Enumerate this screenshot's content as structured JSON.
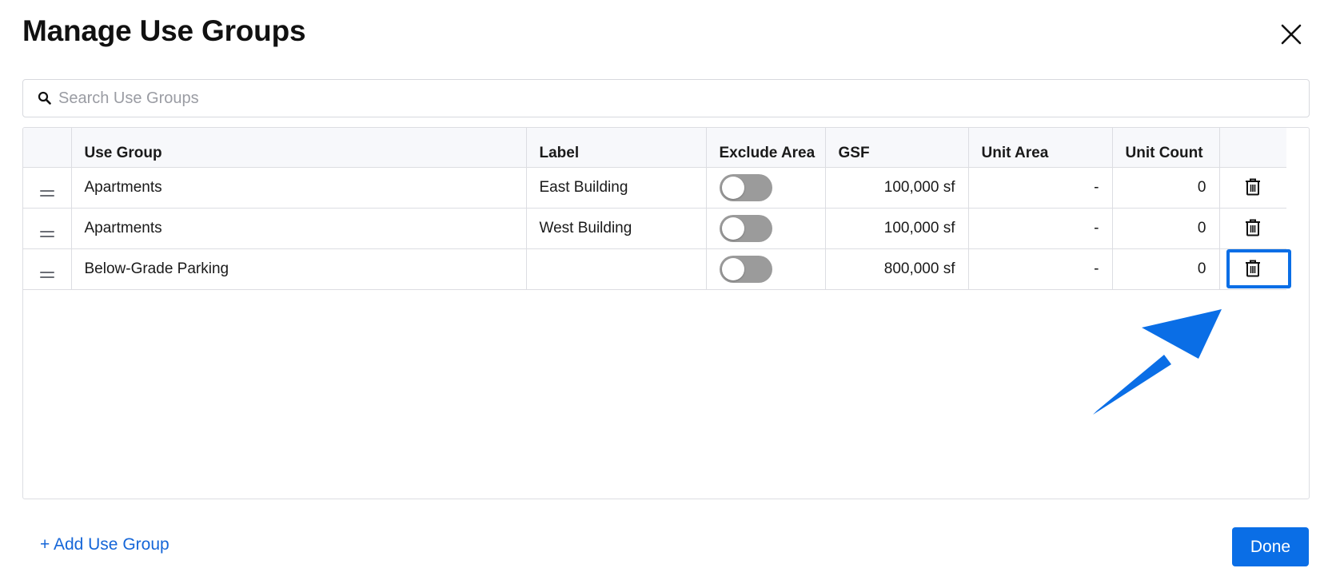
{
  "dialog": {
    "title": "Manage Use Groups",
    "close_icon": "close-icon"
  },
  "search": {
    "placeholder": "Search Use Groups",
    "value": "",
    "icon": "search-icon"
  },
  "table": {
    "columns": [
      "",
      "Use Group",
      "Label",
      "Exclude Area",
      "GSF",
      "Unit Area",
      "Unit Count",
      ""
    ],
    "rows": [
      {
        "use_group": "Apartments",
        "label": "East Building",
        "exclude_area": false,
        "gsf": "100,000 sf",
        "unit_area": "-",
        "unit_count": "0"
      },
      {
        "use_group": "Apartments",
        "label": "West Building",
        "exclude_area": false,
        "gsf": "100,000 sf",
        "unit_area": "-",
        "unit_count": "0"
      },
      {
        "use_group": "Below-Grade Parking",
        "label": "",
        "exclude_area": false,
        "gsf": "800,000 sf",
        "unit_area": "-",
        "unit_count": "0"
      }
    ]
  },
  "footer": {
    "add_label": "+ Add Use Group",
    "done_label": "Done"
  },
  "annotation": {
    "highlighted_row_index": 2,
    "highlight_color": "#0a6ee6"
  },
  "colors": {
    "accent": "#0a6ee6",
    "toggle_off": "#9b9b9b",
    "link": "#1566d8"
  }
}
